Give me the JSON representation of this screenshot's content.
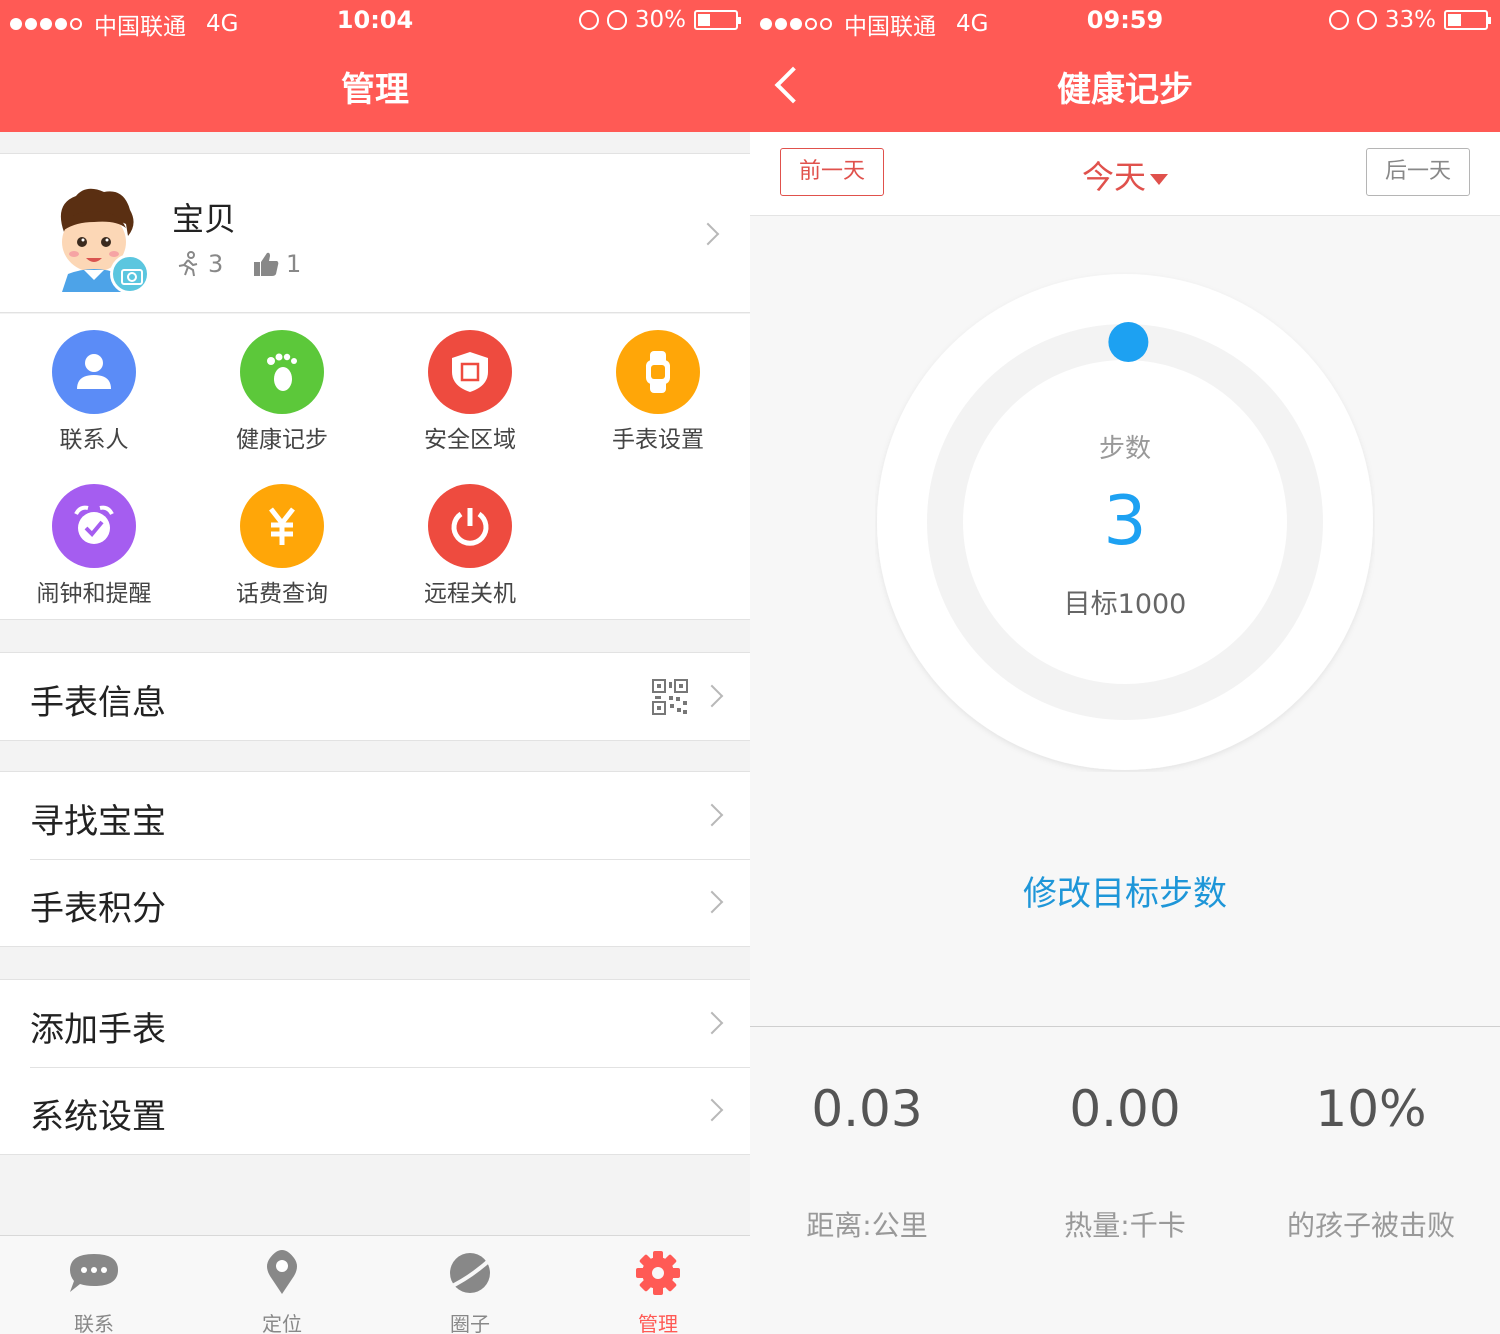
{
  "left": {
    "status": {
      "carrier": "中国联通",
      "network": "4G",
      "time": "10:04",
      "battery": "30%",
      "battery_level": 0.3
    },
    "nav": {
      "title": "管理"
    },
    "profile": {
      "name": "宝贝",
      "steps_badge": "3",
      "likes_badge": "1"
    },
    "grid": [
      {
        "label": "联系人",
        "icon": "contacts-icon",
        "color": "#5b8cf7"
      },
      {
        "label": "健康记步",
        "icon": "footprint-icon",
        "color": "#5cc83a"
      },
      {
        "label": "安全区域",
        "icon": "shield-icon",
        "color": "#ee4b3f"
      },
      {
        "label": "手表设置",
        "icon": "watch-icon",
        "color": "#ffa608"
      },
      {
        "label": "闹钟和提醒",
        "icon": "alarm-icon",
        "color": "#a55df0"
      },
      {
        "label": "话费查询",
        "icon": "yuan-icon",
        "color": "#ffa608"
      },
      {
        "label": "远程关机",
        "icon": "power-icon",
        "color": "#ee4b3f"
      }
    ],
    "list": {
      "watch_info": "手表信息",
      "find_baby": "寻找宝宝",
      "watch_points": "手表积分",
      "add_watch": "添加手表",
      "system_settings": "系统设置"
    },
    "tabs": [
      {
        "label": "联系",
        "icon": "chat-icon"
      },
      {
        "label": "定位",
        "icon": "location-pin-icon"
      },
      {
        "label": "圈子",
        "icon": "planet-icon"
      },
      {
        "label": "管理",
        "icon": "gear-icon"
      }
    ],
    "accent": "#ff5a55"
  },
  "right": {
    "status": {
      "carrier": "中国联通",
      "network": "4G",
      "time": "09:59",
      "battery": "33%",
      "battery_level": 0.33
    },
    "nav": {
      "title": "健康记步"
    },
    "day": {
      "prev": "前一天",
      "current": "今天",
      "next": "后一天"
    },
    "ring": {
      "title": "步数",
      "value": "3",
      "goal": "目标1000",
      "progress": 0.003
    },
    "edit_goal": "修改目标步数",
    "metrics": [
      {
        "value": "0.03",
        "label": "距离:公里"
      },
      {
        "value": "0.00",
        "label": "热量:千卡"
      },
      {
        "value": "10%",
        "label": "的孩子被击败"
      }
    ],
    "accent": "#1da1f2"
  }
}
